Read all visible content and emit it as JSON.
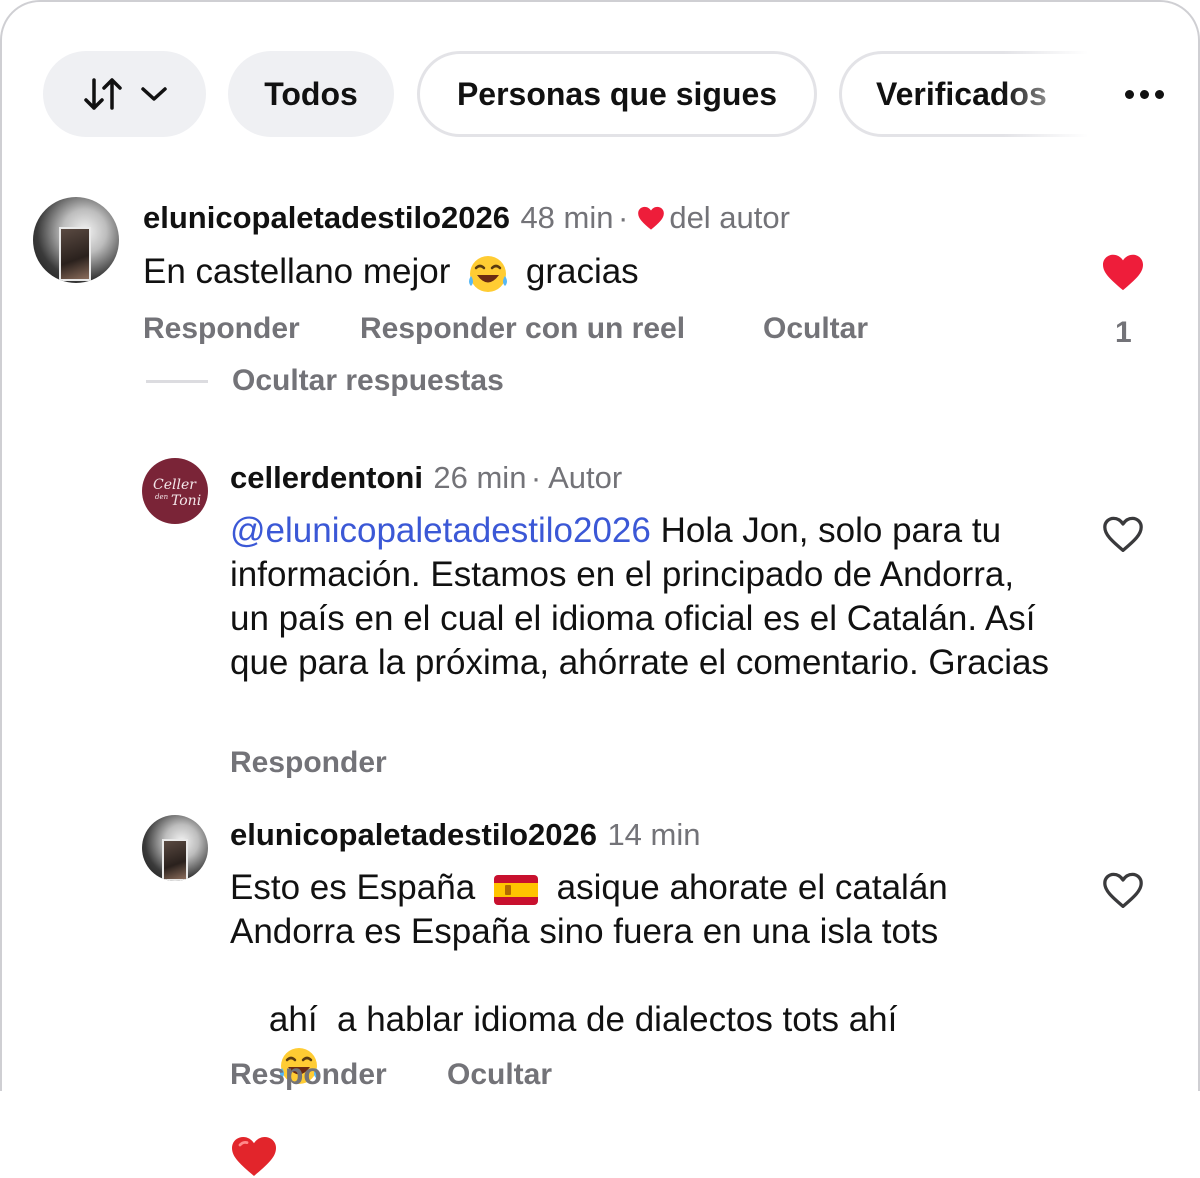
{
  "filters": {
    "all_label": "Todos",
    "following_label": "Personas que sigues",
    "verified_label": "Verificados"
  },
  "comments": [
    {
      "username": "elunicopaletadestilo2026",
      "time": "48 min",
      "liked_by_author": "del autor",
      "text": "En castellano mejor",
      "text_after_emoji": "gracias",
      "actions": [
        "Responder",
        "Responder con un reel",
        "Ocultar"
      ],
      "like_count": "1",
      "hide_replies": "Ocultar respuestas"
    },
    {
      "username": "cellerdentoni",
      "time": "26 min",
      "badge": "Autor",
      "avatar_text": "Celler den Toni",
      "mention": "@elunicopaletadestilo2026",
      "text": "Hola Jon, solo para tu información. Estamos en el principado de Andorra, un país en el cual el idioma oficial es el Catalán. Así que para la próxima, ahórrate el comentario. Gracias",
      "actions": [
        "Responder"
      ]
    },
    {
      "username": "elunicopaletadestilo2026",
      "time": "14 min",
      "text_1": "Esto es España",
      "text_2": "asique ahorate el catalán",
      "text_3": "Andorra es España sino fuera en una isla tots",
      "text_4": "ahí  a hablar idioma de dialectos tots ahí",
      "actions": [
        "Responder",
        "Ocultar"
      ]
    }
  ],
  "colors": {
    "heart_red": "#ee1d3a",
    "mention_blue": "#3b58d6",
    "secondary_text": "#737378"
  },
  "icons": [
    "sort-icon",
    "chevron-down-icon",
    "more-icon",
    "heart-icon",
    "heart-outline-icon",
    "laughing-emoji-icon",
    "spain-flag-icon",
    "red-heart-emoji-icon"
  ]
}
